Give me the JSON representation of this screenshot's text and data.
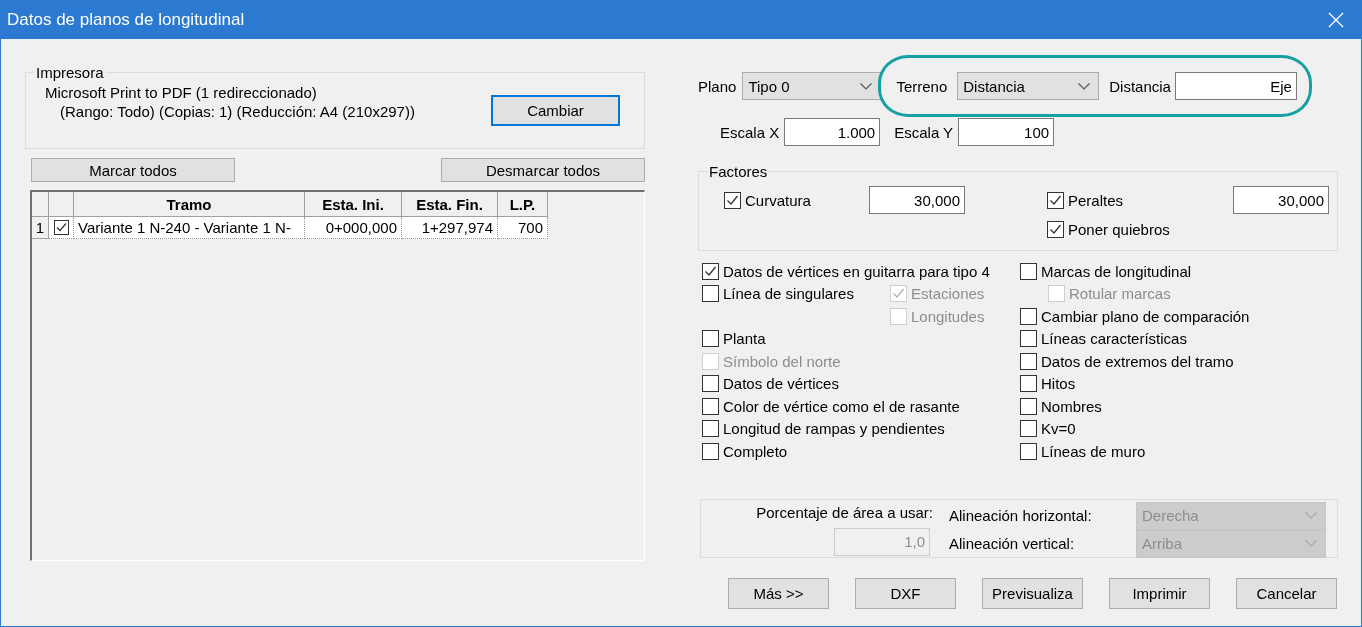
{
  "window": {
    "title": "Datos de planos de longitudinal"
  },
  "printer": {
    "legend": "Impresora",
    "name": "Microsoft Print to PDF (1 redireccionado)",
    "details": "(Rango: Todo) (Copias: 1) (Reducción: A4 (210x297))",
    "change_button": {
      "label": "Cambiar",
      "focused": true
    }
  },
  "selection_buttons": [
    "Marcar todos",
    "Desmarcar todos"
  ],
  "table": {
    "columns": [
      "Tramo",
      "Esta. Ini.",
      "Esta. Fin.",
      "L.P."
    ],
    "rows": [
      {
        "number": "1",
        "checked": true,
        "cells": [
          "Variante 1 N-240 - Variante 1 N-",
          "0+000,000",
          "1+297,974",
          "700"
        ]
      }
    ]
  },
  "plano": {
    "label": "Plano",
    "value": "Tipo 0"
  },
  "terreno": {
    "label": "Terreno",
    "value": "Distancia"
  },
  "distancia": {
    "label": "Distancia",
    "value": "Eje"
  },
  "escala_x": {
    "label": "Escala X",
    "value": "1.000"
  },
  "escala_y": {
    "label": "Escala Y",
    "value": "100"
  },
  "factores": {
    "legend": "Factores",
    "items": [
      {
        "label": "Curvatura",
        "checked": true,
        "value": "30,000"
      },
      {
        "label": "Peraltes",
        "checked": true,
        "value": "30,000"
      },
      {
        "label": "Poner quiebros",
        "checked": true
      }
    ]
  },
  "options_left": [
    {
      "label": "Datos de vértices en guitarra para tipo 4",
      "checked": true,
      "disabled": false
    },
    {
      "label": "Línea de singulares",
      "checked": false,
      "disabled": false,
      "children": [
        {
          "label": "Estaciones",
          "checked": true,
          "disabled": true
        },
        {
          "label": "Longitudes",
          "checked": false,
          "disabled": true
        }
      ]
    },
    {
      "label": "Planta",
      "checked": false,
      "disabled": false
    },
    {
      "label": "Símbolo del norte",
      "checked": false,
      "disabled": true
    },
    {
      "label": "Datos de vértices",
      "checked": false,
      "disabled": false
    },
    {
      "label": "Color de vértice como el de rasante",
      "checked": false,
      "disabled": false
    },
    {
      "label": "Longitud de rampas y pendientes",
      "checked": false,
      "disabled": false
    },
    {
      "label": "Completo",
      "checked": false,
      "disabled": false
    }
  ],
  "options_right": [
    {
      "label": "Marcas de longitudinal",
      "checked": false,
      "disabled": false,
      "children": [
        {
          "label": "Rotular marcas",
          "checked": false,
          "disabled": true
        }
      ]
    },
    {
      "label": "Cambiar plano de comparación",
      "checked": false,
      "disabled": false
    },
    {
      "label": "Líneas características",
      "checked": false,
      "disabled": false
    },
    {
      "label": "Datos de extremos del tramo",
      "checked": false,
      "disabled": false
    },
    {
      "label": "Hitos",
      "checked": false,
      "disabled": false
    },
    {
      "label": "Nombres",
      "checked": false,
      "disabled": false
    },
    {
      "label": "Kv=0",
      "checked": false,
      "disabled": false
    },
    {
      "label": "Líneas de muro",
      "checked": false,
      "disabled": false
    }
  ],
  "area": {
    "label": "Porcentaje de área a usar:",
    "value": "1,0",
    "disabled": true
  },
  "alignment": [
    {
      "label": "Alineación horizontal:",
      "value": "Derecha",
      "disabled": true
    },
    {
      "label": "Alineación vertical:",
      "value": "Arriba",
      "disabled": true
    }
  ],
  "buttons": [
    "Más >>",
    "DXF",
    "Previsualiza",
    "Imprimir",
    "Cancelar"
  ]
}
